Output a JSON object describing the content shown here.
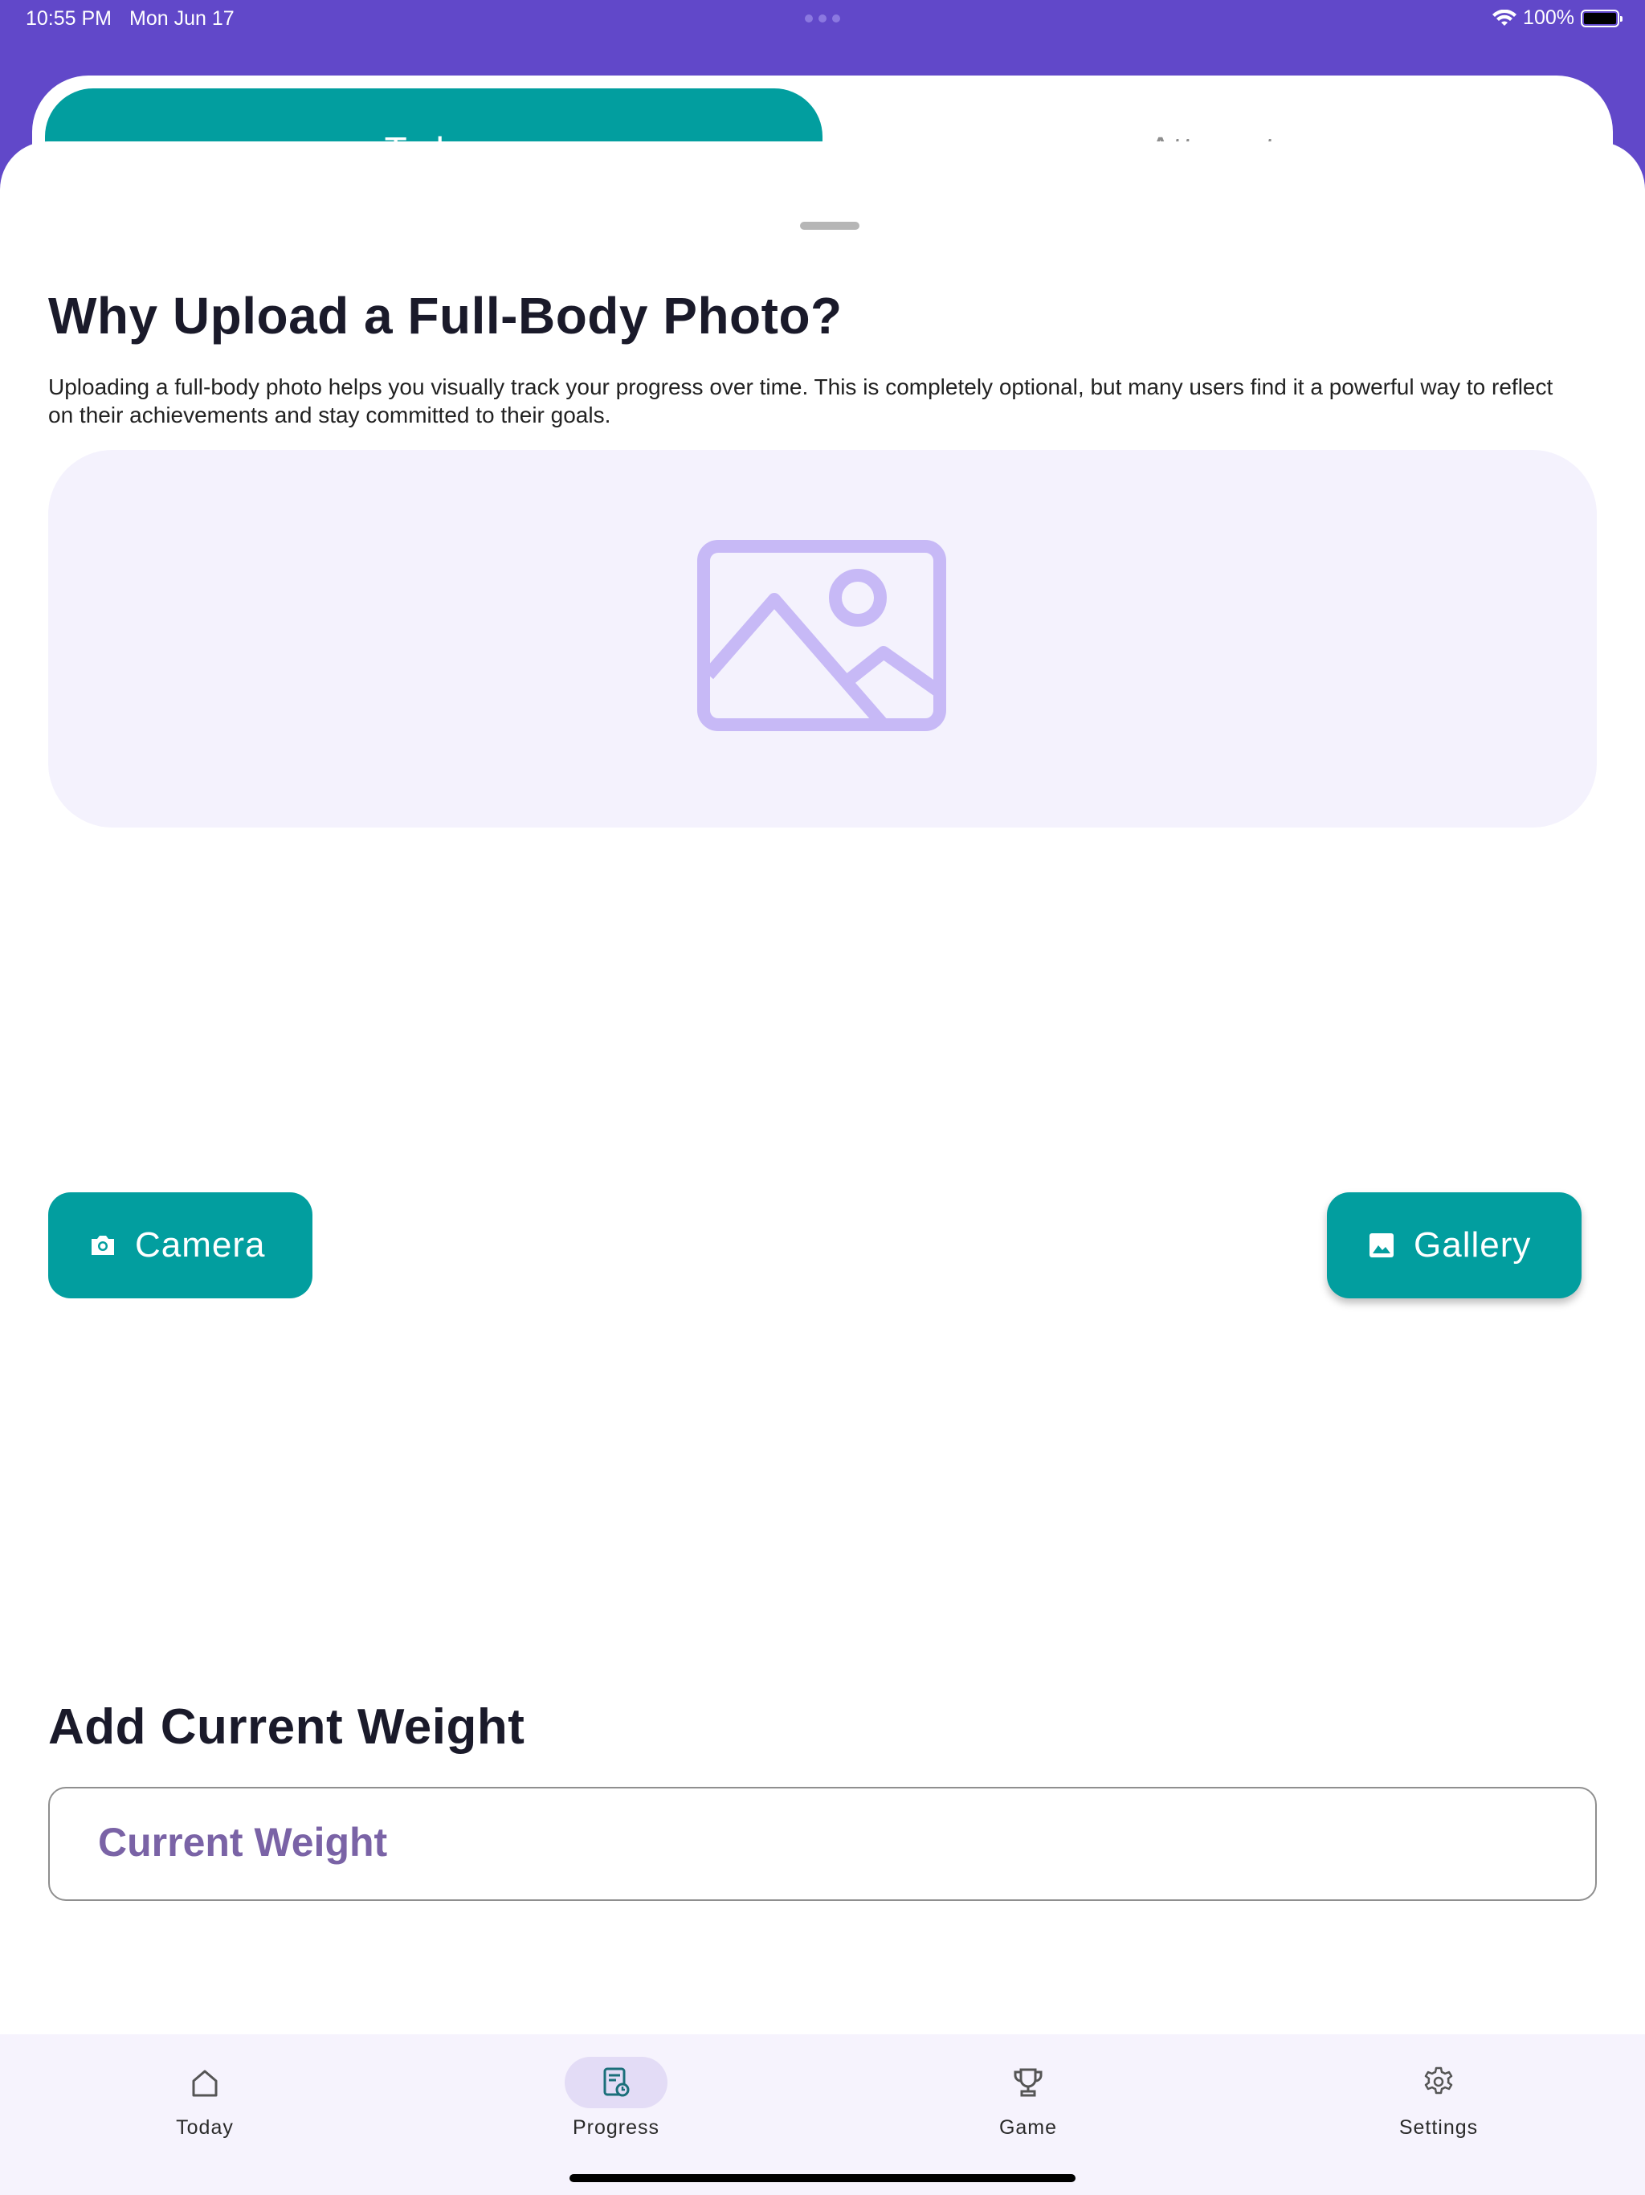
{
  "status_bar": {
    "time": "10:55 PM",
    "date": "Mon Jun 17",
    "battery": "100%"
  },
  "tabs": {
    "today": "Today",
    "attempts": "Attempts",
    "active": "Today"
  },
  "sheet": {
    "title": "Why Upload a Full-Body Photo?",
    "description": "Uploading a full-body photo helps you visually track your progress over time. This is completely optional, but many users find it a powerful way to reflect on their achievements and stay committed to their goals.",
    "placeholder_icon": "image-icon",
    "camera_label": "Camera",
    "gallery_label": "Gallery",
    "weight_title": "Add Current Weight",
    "weight_placeholder": "Current Weight"
  },
  "bottom_nav": {
    "items": [
      {
        "label": "Today",
        "icon": "home-icon"
      },
      {
        "label": "Progress",
        "icon": "progress-icon",
        "active": true
      },
      {
        "label": "Game",
        "icon": "trophy-icon"
      },
      {
        "label": "Settings",
        "icon": "gear-icon"
      }
    ]
  },
  "colors": {
    "header": "#6148c9",
    "accent": "#029e9f",
    "placeholder_bg": "#f4f2fd",
    "placeholder_icon": "#c7b9f6",
    "field_label": "#7a63a6"
  }
}
